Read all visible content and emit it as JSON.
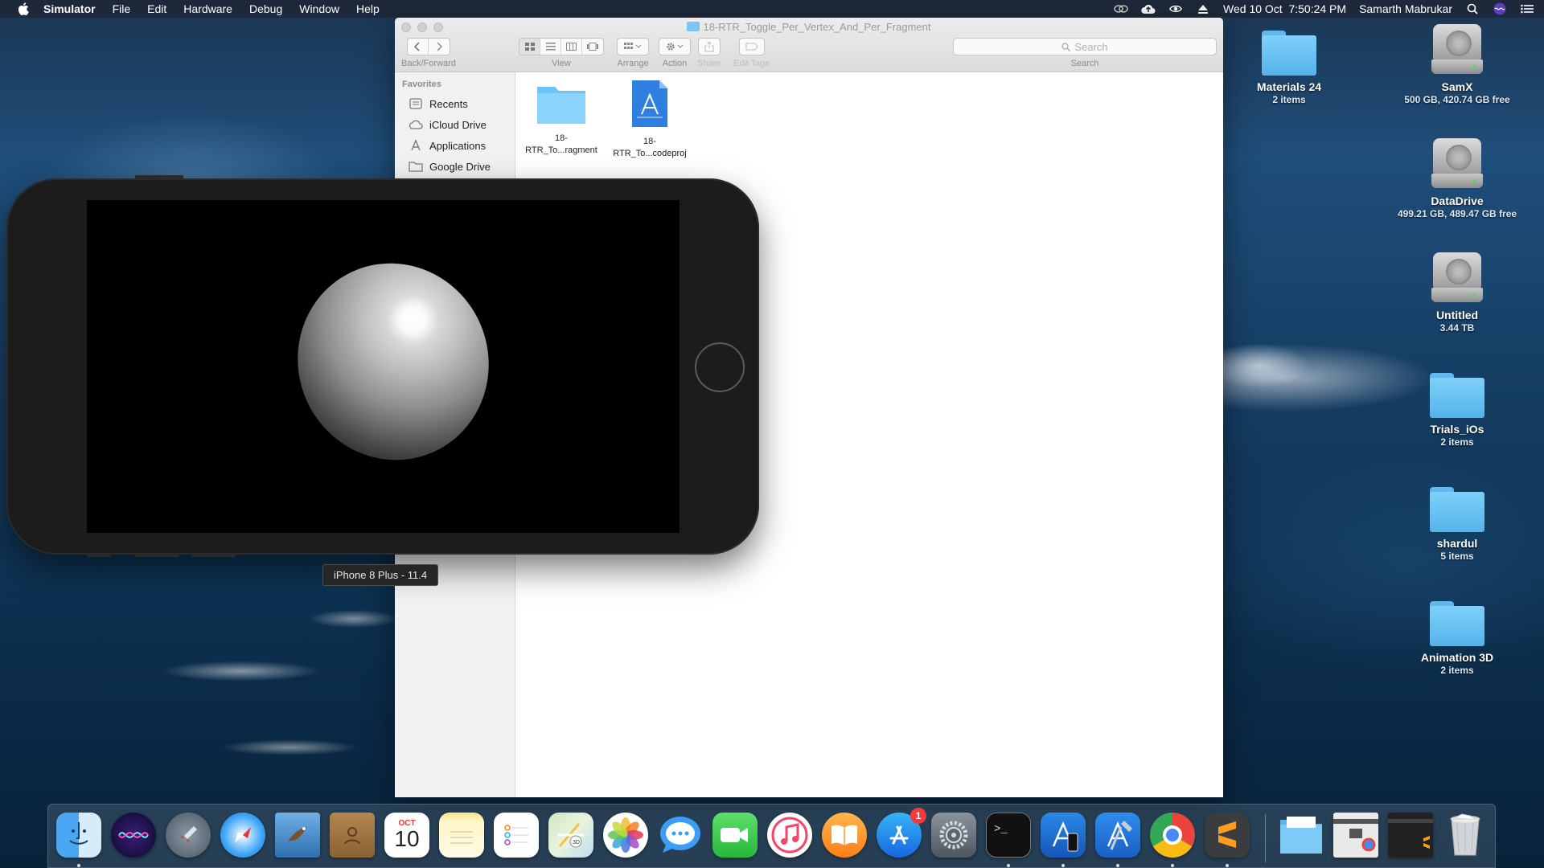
{
  "menubar": {
    "app_name": "Simulator",
    "items": [
      "File",
      "Edit",
      "Hardware",
      "Debug",
      "Window",
      "Help"
    ],
    "clock": "Wed 10 Oct  7:50:24 PM",
    "user": "Samarth Mabrukar"
  },
  "finder": {
    "title": "18-RTR_Toggle_Per_Vertex_And_Per_Fragment",
    "toolbar": {
      "back_forward_label": "Back/Forward",
      "view_label": "View",
      "arrange_label": "Arrange",
      "action_label": "Action",
      "share_label": "Share",
      "edit_tags_label": "Edit Tags",
      "search_label": "Search",
      "search_placeholder": "Search"
    },
    "sidebar": {
      "heading": "Favorites",
      "items": [
        {
          "label": "Recents",
          "icon": "recents-icon"
        },
        {
          "label": "iCloud Drive",
          "icon": "cloud-icon"
        },
        {
          "label": "Applications",
          "icon": "applications-icon"
        },
        {
          "label": "Google Drive",
          "icon": "folder-icon"
        }
      ]
    },
    "files": [
      {
        "line1": "18-",
        "line2": "RTR_To...ragment",
        "icon": "folder-icon"
      },
      {
        "line1": "18-",
        "line2": "RTR_To...codeproj",
        "icon": "xcodeproj-icon"
      }
    ]
  },
  "simulator": {
    "device_tooltip": "iPhone 8 Plus - 11.4"
  },
  "desktop": [
    {
      "name": "Materials 24",
      "sub": "2 items",
      "icon": "folder-icon"
    },
    {
      "name": "SamX",
      "sub": "500 GB, 420.74 GB free",
      "icon": "disk-icon"
    },
    {
      "name": "DataDrive",
      "sub": "499.21 GB, 489.47 GB free",
      "icon": "disk-icon"
    },
    {
      "name": "Untitled",
      "sub": "3.44 TB",
      "icon": "disk-icon"
    },
    {
      "name": "Trials_iOs",
      "sub": "2 items",
      "icon": "folder-icon"
    },
    {
      "name": "shardul",
      "sub": "5 items",
      "icon": "folder-icon"
    },
    {
      "name": "Animation 3D",
      "sub": "2 items",
      "icon": "folder-icon"
    }
  ],
  "dock": {
    "calendar_month": "OCT",
    "calendar_day": "10",
    "app_store_badge": "1",
    "apps": [
      "finder",
      "siri",
      "launchpad",
      "safari",
      "mail",
      "contacts",
      "calendar",
      "notes",
      "reminders",
      "maps",
      "photos",
      "messages",
      "facetime",
      "itunes",
      "ibooks",
      "app-store",
      "system-preferences",
      "terminal",
      "xcode-simulator",
      "xcode",
      "chrome",
      "sublime-text",
      "downloads-folder",
      "chrome-window",
      "sublime-window",
      "trash"
    ]
  },
  "colors": {
    "folder_blue": "#6cc3f4",
    "accent_blue": "#2f7fe0",
    "menubar_bg": "#1e2837"
  }
}
